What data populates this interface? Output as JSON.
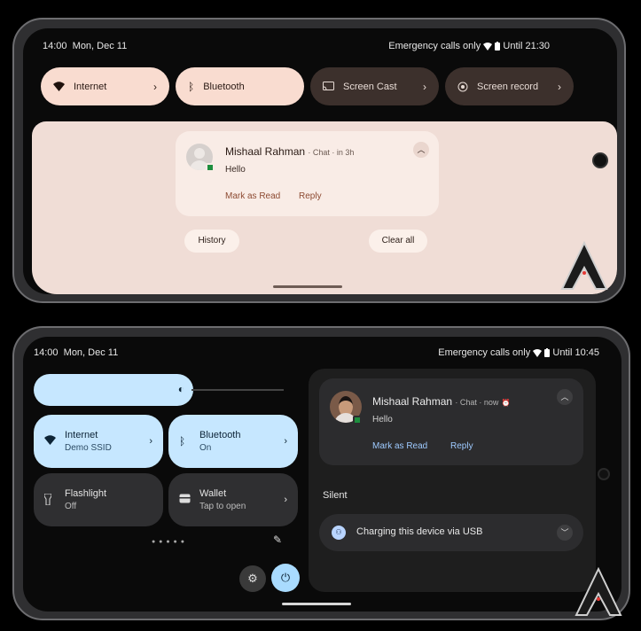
{
  "top_screen": {
    "status": {
      "time": "14:00",
      "date": "Mon, Dec 11",
      "right_text": "Emergency calls only",
      "until": "Until 21:30"
    },
    "tiles": [
      {
        "label": "Internet",
        "icon": "wifi-icon"
      },
      {
        "label": "Bluetooth",
        "icon": "bluetooth-icon"
      },
      {
        "label": "Screen Cast",
        "icon": "cast-icon"
      },
      {
        "label": "Screen record",
        "icon": "record-icon"
      }
    ],
    "notification": {
      "sender": "Mishaal Rahman",
      "meta": "· Chat · in 3h",
      "message": "Hello",
      "action_1": "Mark as Read",
      "action_2": "Reply"
    },
    "history_label": "History",
    "clear_all_label": "Clear all",
    "colors": {
      "shade": "#f0ddd6",
      "tile_active": "#f9dcd0",
      "action": "#8d4a32"
    }
  },
  "bottom_screen": {
    "status": {
      "time": "14:00",
      "date": "Mon, Dec 11",
      "right_text": "Emergency calls only",
      "until": "Until 10:45"
    },
    "tiles": {
      "internet": {
        "label": "Internet",
        "sub": "Demo SSID"
      },
      "bluetooth": {
        "label": "Bluetooth",
        "sub": "On"
      },
      "flashlight": {
        "label": "Flashlight",
        "sub": "Off"
      },
      "wallet": {
        "label": "Wallet",
        "sub": "Tap to open"
      }
    },
    "notification": {
      "sender": "Mishaal Rahman",
      "meta": "· Chat · now",
      "message": "Hello",
      "action_1": "Mark as Read",
      "action_2": "Reply"
    },
    "silent_label": "Silent",
    "charging_text": "Charging this device via USB",
    "colors": {
      "tile_active": "#c6e7ff",
      "action": "#9ecaff"
    }
  }
}
